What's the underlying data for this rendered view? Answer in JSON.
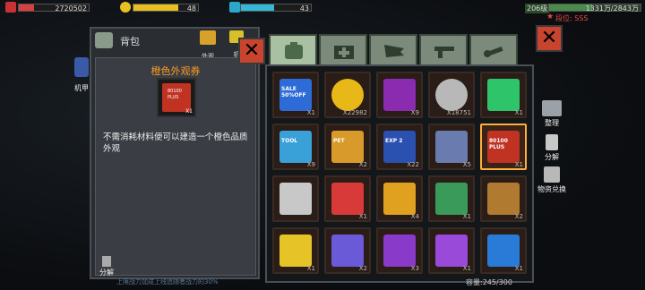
{
  "hud": {
    "hp_value": "2720502",
    "gold_value": "48",
    "mana_value": "43",
    "level_label": "206级",
    "exp_value": "1331万/2843万",
    "rank_label": "段位: SSS"
  },
  "left_nav": {
    "mecha_label": "机甲"
  },
  "panel": {
    "title": "背包",
    "header_tabs": [
      {
        "label": "外观"
      },
      {
        "label": "机"
      }
    ]
  },
  "selected_item": {
    "name": "橙色外观券",
    "card_text": "80100 PLUS",
    "quantity": "X1",
    "description": "不需消耗材料便可以建造一个橙色品质外观"
  },
  "tabs": [
    {
      "name": "backpack-tab",
      "active": true
    },
    {
      "name": "medkit-tab",
      "active": false
    },
    {
      "name": "wings-tab",
      "active": false
    },
    {
      "name": "gun-tab",
      "active": false
    },
    {
      "name": "wrench-tab",
      "active": false
    }
  ],
  "inventory": [
    {
      "kind": "sale-ticket",
      "label": "SALE 50%OFF",
      "qty": "X1",
      "color": "#2d6bd6"
    },
    {
      "kind": "gold-coin",
      "label": "",
      "qty": "X22982",
      "color": "#e8b818"
    },
    {
      "kind": "cocktail",
      "label": "",
      "qty": "X9",
      "color": "#8a2bb0"
    },
    {
      "kind": "silver-coin",
      "label": "",
      "qty": "X18751",
      "color": "#b8b8b8"
    },
    {
      "kind": "green-ticket",
      "label": "",
      "qty": "X1",
      "color": "#2ec46a"
    },
    {
      "kind": "tool-card",
      "label": "TOOL",
      "qty": "X9",
      "color": "#3aa0d8"
    },
    {
      "kind": "pet-card",
      "label": "PET",
      "qty": "X2",
      "color": "#d89a2a"
    },
    {
      "kind": "exp-card",
      "label": "EXP 2",
      "qty": "X22",
      "color": "#2a50b0"
    },
    {
      "kind": "map-scroll",
      "label": "",
      "qty": "X5",
      "color": "#6a7bb0"
    },
    {
      "kind": "orange-ticket",
      "label": "80100 PLUS",
      "qty": "X1",
      "color": "#c03222",
      "selected": true
    },
    {
      "kind": "red-crate",
      "label": "",
      "qty": "",
      "color": "#c8c8c8"
    },
    {
      "kind": "gold-chest-red",
      "label": "",
      "qty": "X1",
      "color": "#d83a3a"
    },
    {
      "kind": "gold-chest-orange",
      "label": "",
      "qty": "X4",
      "color": "#e0a020"
    },
    {
      "kind": "green-chest",
      "label": "",
      "qty": "X1",
      "color": "#3a9a5a"
    },
    {
      "kind": "bronze-chest",
      "label": "",
      "qty": "X2",
      "color": "#b07a30"
    },
    {
      "kind": "gold-chest",
      "label": "",
      "qty": "X1",
      "color": "#e6c428"
    },
    {
      "kind": "purple-chest-blue",
      "label": "",
      "qty": "X2",
      "color": "#6a5ad8"
    },
    {
      "kind": "purple-chest-gold",
      "label": "",
      "qty": "X3",
      "color": "#8a3ac8"
    },
    {
      "kind": "purple-crate",
      "label": "",
      "qty": "X1",
      "color": "#9a4ad8"
    },
    {
      "kind": "blue-chest",
      "label": "",
      "qty": "X1",
      "color": "#2a7ad8"
    }
  ],
  "side_buttons": [
    {
      "label": "整理"
    },
    {
      "label": "分解"
    },
    {
      "label": "物资兑换"
    }
  ],
  "footer": {
    "decompose_label": "分解",
    "hint_text": "上限战力加成上线追随者战力的30%",
    "capacity": "容量:245/300"
  }
}
